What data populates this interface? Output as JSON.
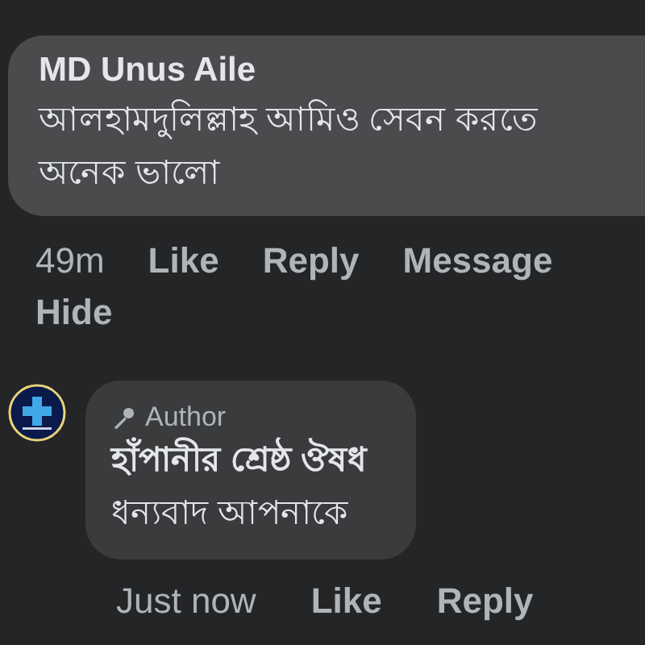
{
  "comment": {
    "author": "MD Unus Aile",
    "lines": [
      "আলহামদুলিল্লাহ আমিও সেবন করতে",
      "অনেক ভালো"
    ],
    "actions": [
      "49m",
      "Like",
      "Reply",
      "Message",
      "Hide"
    ]
  },
  "reply": {
    "badge": "Author",
    "author": "হাঁপানীর শ্রেষ্ঠ ঔষধ",
    "text": "ধন্যবাদ আপনাকে",
    "actions": [
      "Just now",
      "Like",
      "Reply"
    ]
  }
}
